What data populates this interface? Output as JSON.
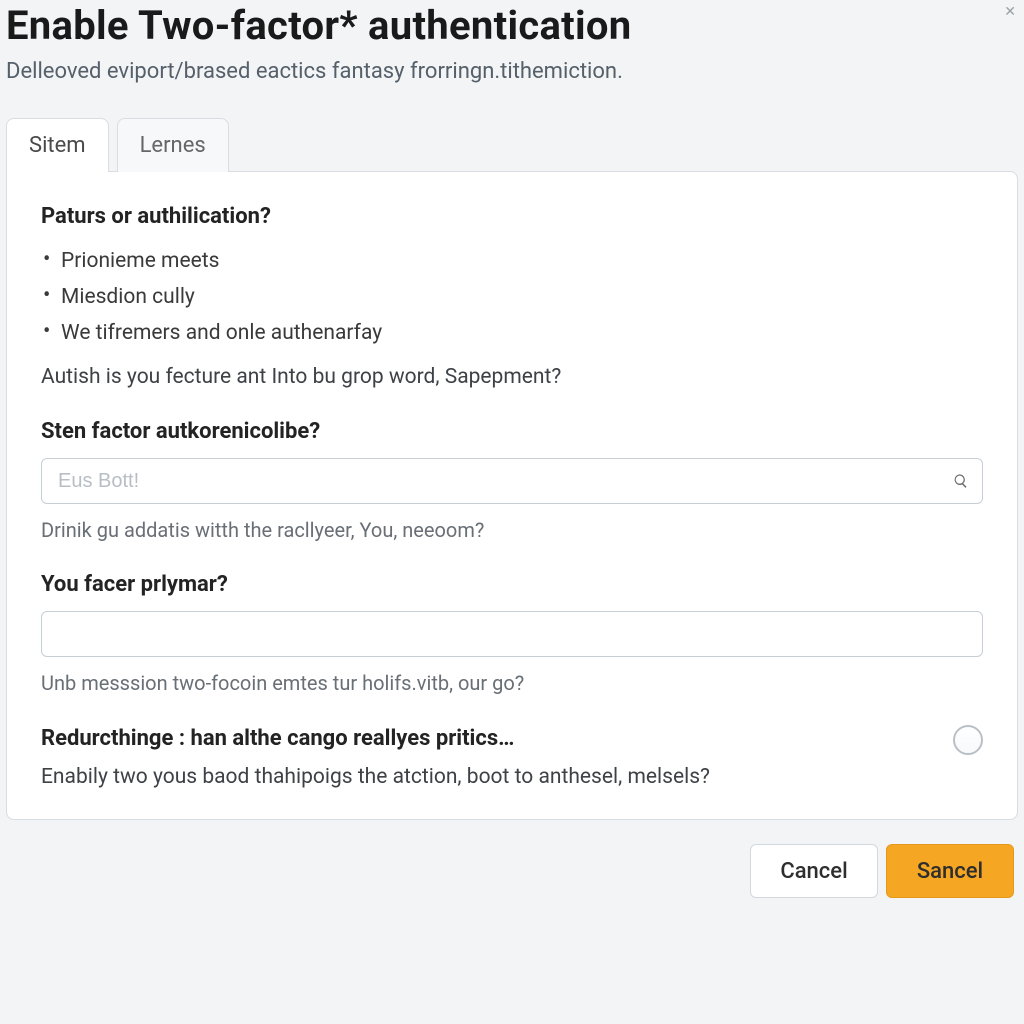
{
  "header": {
    "title": "Enable Two-factor* authentication",
    "subtitle": "Delleoved eviport/brased eactics fantasy frorringn.tithemiction."
  },
  "tabs": {
    "active": "Sitem",
    "inactive": "Lernes"
  },
  "section1": {
    "heading": "Paturs or authilication?",
    "b1": "Prionieme meets",
    "b2": "Miesdion cully",
    "b3": "We tifremers and onle authenarfay",
    "body": "Autish is you fecture ant Into bu grop word, Sapepment?"
  },
  "section2": {
    "heading": "Sten factor autkorenicolibe?",
    "placeholder": "Eus Bott!",
    "helper": "Drinik gu addatis witth the racllyeer, You, neeoom?"
  },
  "section3": {
    "heading": "You facer prlymar?",
    "placeholder": "",
    "helper": "Unb messsion two-focoin emtes tur holifs.vitb, our go?"
  },
  "section4": {
    "heading": "Redurcthinge : han althe cango reallyes pritics…",
    "body": "Enabily two yous baod thahipoigs the atction, boot to anthesel, melsels?"
  },
  "footer": {
    "cancel": "Cancel",
    "primary": "Sancel"
  }
}
